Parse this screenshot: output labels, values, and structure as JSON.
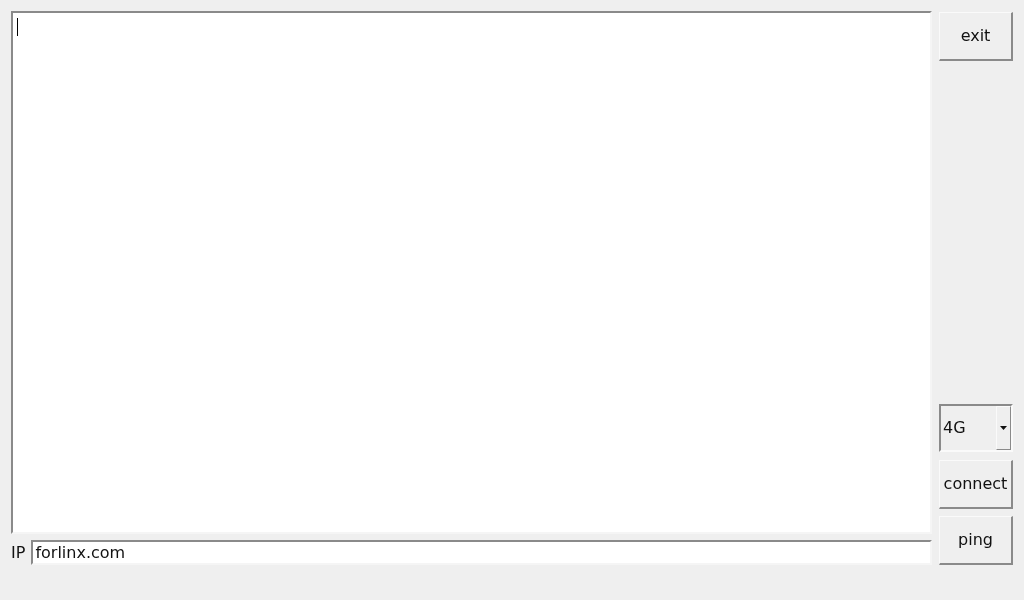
{
  "log_area": {
    "focused": true
  },
  "buttons_top": [
    "exit"
  ],
  "mode_select": {
    "value": "4G"
  },
  "buttons_bottom": [
    "connect",
    "ping"
  ],
  "ip_field": {
    "label": "IP",
    "value": "forlinx.com"
  }
}
